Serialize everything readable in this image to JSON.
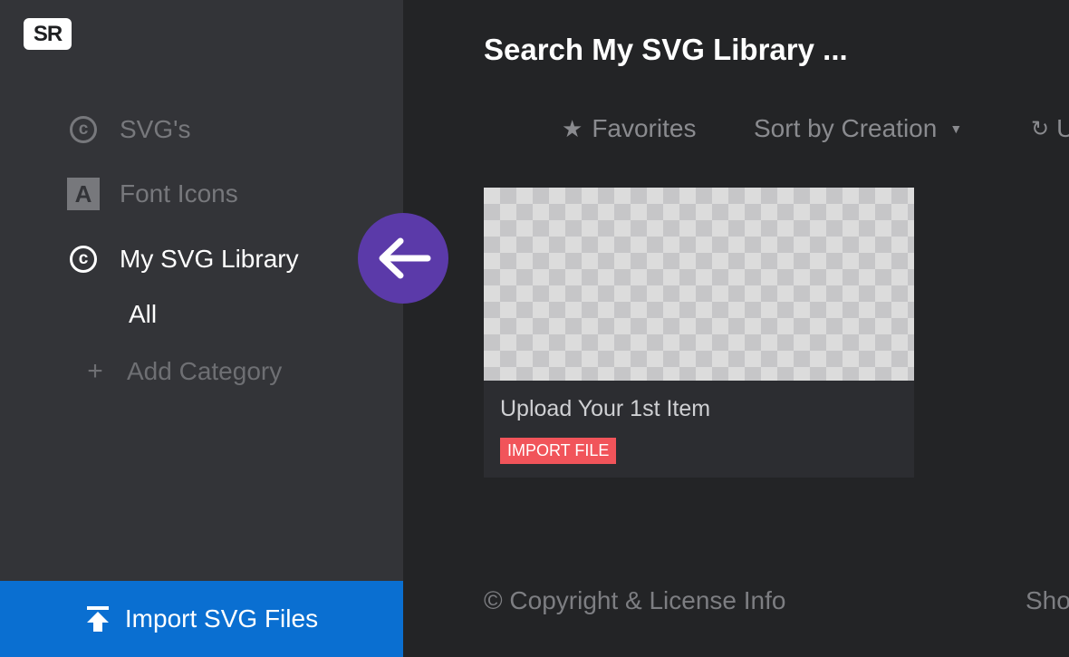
{
  "logo": {
    "text": "SR"
  },
  "sidebar": {
    "items": [
      {
        "label": "SVG's",
        "icon": "copyright-circle-icon"
      },
      {
        "label": "Font Icons",
        "icon": "font-a-icon"
      },
      {
        "label": "My SVG Library",
        "icon": "copyright-circle-icon",
        "active": true
      }
    ],
    "sub_items": [
      {
        "label": "All"
      }
    ],
    "add_category": "Add Category",
    "import_button": "Import SVG Files"
  },
  "main": {
    "search_title": "Search My SVG Library ...",
    "toolbar": {
      "favorites": "Favorites",
      "sort": "Sort by Creation",
      "update": "U"
    },
    "card": {
      "title": "Upload Your 1st Item",
      "action": "IMPORT FILE"
    },
    "footer": {
      "copyright": "© Copyright & License Info",
      "right": "Sho"
    }
  },
  "colors": {
    "accent_blue": "#0a6fd1",
    "accent_purple": "#5b3aa9",
    "import_red": "#f1545a"
  }
}
